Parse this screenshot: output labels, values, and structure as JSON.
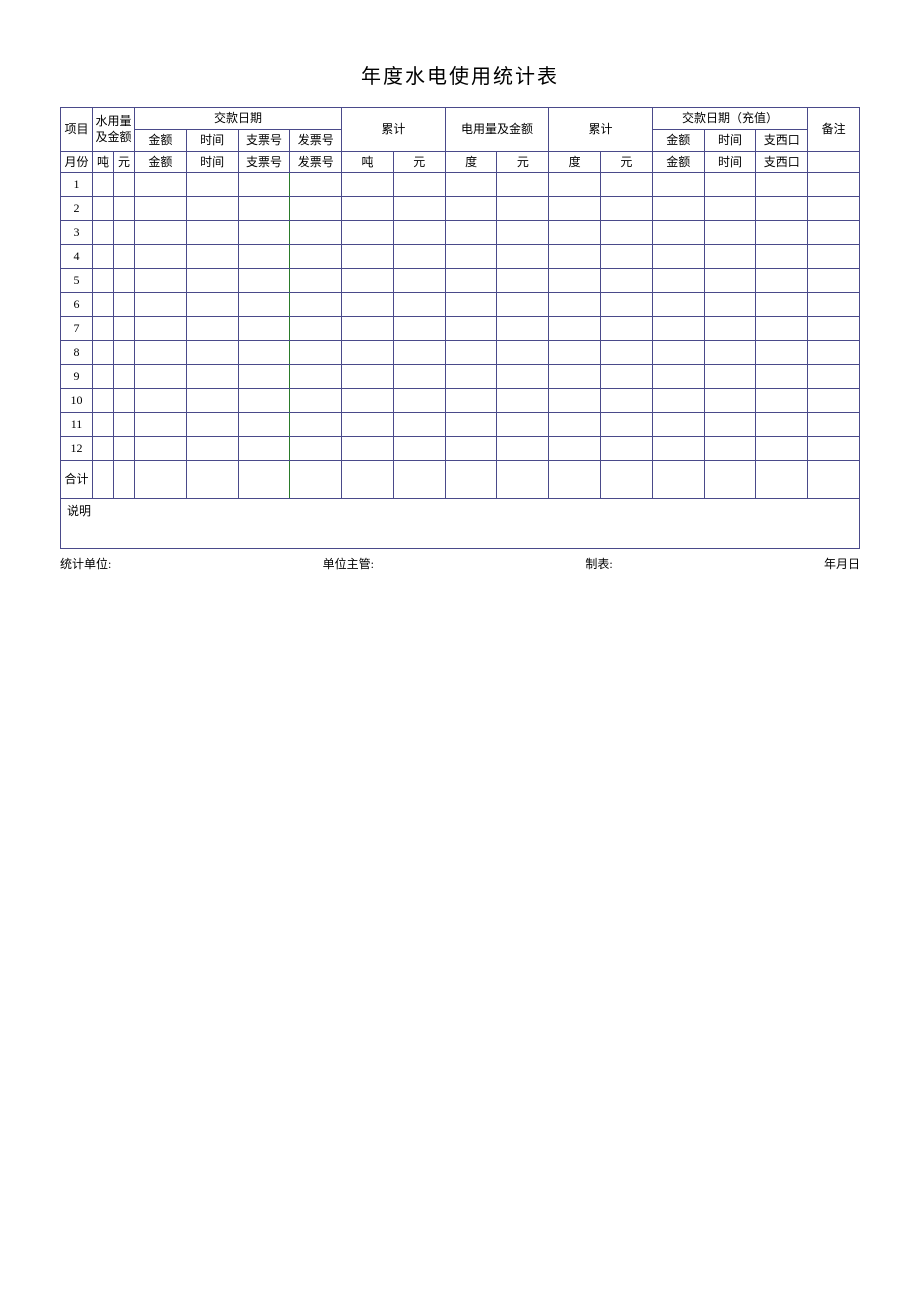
{
  "title": "年度水电使用统计表",
  "table": {
    "headers": {
      "row1": {
        "xm": "项目",
        "shuiyong": "水用量及金额",
        "jiaokuan": "交款日期",
        "leiji": "累计",
        "dianyong": "电用量及金额",
        "dleiji": "累计",
        "chongzhi": "交款日期（充值）",
        "beizhu": "备注"
      },
      "row2": {
        "yuefen": "月份",
        "ton": "吨",
        "yuan": "元",
        "jine": "金额",
        "shijian": "时间",
        "zhipiaohao": "支票号",
        "fapiaohao": "发票号",
        "leiji_ton": "吨",
        "leiji_yuan": "元",
        "du": "度",
        "dy_yuan": "元",
        "dleiji_du": "度",
        "dleiji_yuan": "元",
        "cz_jine": "金额",
        "cz_shijian": "时间",
        "cz_zhipiao": "支西口"
      }
    },
    "months": [
      "1",
      "2",
      "3",
      "4",
      "5",
      "6",
      "7",
      "8",
      "9",
      "10",
      "11",
      "12",
      "合计"
    ],
    "shuiming": "说明",
    "shuiming_label": "说明"
  },
  "footer": {
    "tongji": "统计单位:",
    "danwei": "单位主管:",
    "zhibiao": "制表:",
    "nianyueiri": "年月日"
  }
}
